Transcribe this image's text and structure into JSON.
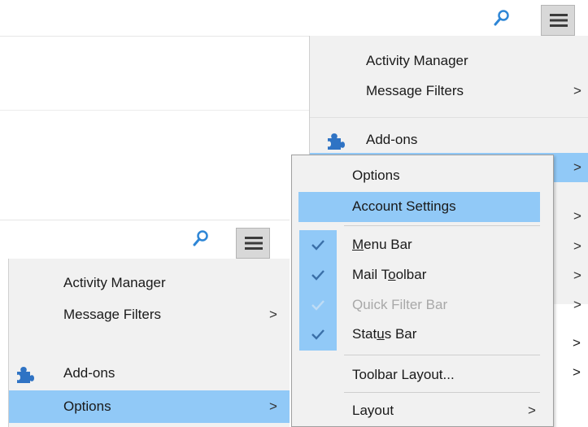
{
  "back_menu": {
    "items": [
      {
        "label": "Activity Manager"
      },
      {
        "label": "Message Filters",
        "chevron": ">"
      },
      {
        "label": "Add-ons",
        "icon": "puzzle-piece-icon"
      },
      {
        "chevron": ">"
      }
    ],
    "side_chevrons": [
      ">",
      ">",
      ">",
      ">",
      ">",
      ">"
    ]
  },
  "front_menu": {
    "items": [
      {
        "label": "Activity Manager"
      },
      {
        "label": "Message Filters",
        "chevron": ">"
      },
      {
        "label": "Add-ons",
        "icon": "puzzle-piece-icon"
      },
      {
        "label": "Options",
        "chevron": ">"
      }
    ]
  },
  "options_submenu": {
    "options": "Options",
    "account_settings": "Account Settings",
    "menu_bar": {
      "pre": "",
      "u": "M",
      "post": "enu Bar",
      "checked": true
    },
    "mail_toolbar": {
      "pre": "Mail T",
      "u": "o",
      "post": "olbar",
      "checked": true
    },
    "quick_filter_bar": {
      "label": "Quick Filter Bar",
      "checked": true,
      "disabled": true
    },
    "status_bar": {
      "pre": "Stat",
      "u": "u",
      "post": "s Bar",
      "checked": true
    },
    "toolbar_layout": "Toolbar Layout...",
    "layout": "Layout",
    "layout_chevron": ">"
  },
  "colors": {
    "highlight": "#91c9f7",
    "menu_bg": "#f1f1f1",
    "search_icon": "#2e86d6",
    "puzzle_icon": "#2f73c4",
    "check": "#3a6fa8"
  }
}
